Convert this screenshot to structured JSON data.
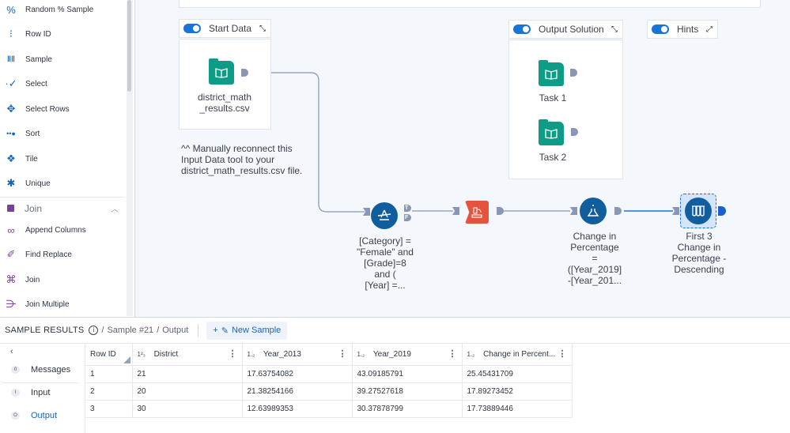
{
  "sidebar": {
    "items": [
      {
        "label": "Random % Sample",
        "icon": "random-sample-icon"
      },
      {
        "label": "Row ID",
        "icon": "row-id-icon"
      },
      {
        "label": "Sample",
        "icon": "sample-icon"
      },
      {
        "label": "Select",
        "icon": "select-icon"
      },
      {
        "label": "Select Rows",
        "icon": "select-rows-icon"
      },
      {
        "label": "Sort",
        "icon": "sort-icon"
      },
      {
        "label": "Tile",
        "icon": "tile-icon"
      },
      {
        "label": "Unique",
        "icon": "unique-icon"
      }
    ],
    "category": {
      "label": "Join",
      "color": "#7a3f9d"
    },
    "join_items": [
      {
        "label": "Append Columns",
        "icon": "append-columns-icon"
      },
      {
        "label": "Find Replace",
        "icon": "find-replace-icon"
      },
      {
        "label": "Join",
        "icon": "join-icon"
      },
      {
        "label": "Join Multiple",
        "icon": "join-multiple-icon"
      }
    ]
  },
  "canvas": {
    "containers": {
      "start_data": {
        "title": "Start Data",
        "node_label": "district_math\n_results.csv"
      },
      "output_solution": {
        "title": "Output Solution",
        "task1": "Task 1",
        "task2": "Task 2"
      },
      "hints": {
        "title": "Hints"
      }
    },
    "comment": "^^ Manually reconnect this Input Data tool to your district_math_results.csv file.",
    "filter_label": "[Category] =\n\"Female\" and\n[Grade]=8\nand (\n[Year] =...",
    "filter_anchors": {
      "true": "T",
      "false": "F"
    },
    "formula_label": "Change in\nPercentage\n=\n([Year_2019]\n-[Year_201...",
    "sample_label": "First 3\nChange in\nPercentage -\nDescending",
    "colors": {
      "input_tool": "#0f9c86",
      "filter_tool": "#115e9e",
      "transpose_tool": "#e5533d",
      "selected_connection": "#1a73d6"
    }
  },
  "results": {
    "title": "SAMPLE RESULTS",
    "breadcrumb": [
      "Sample #21",
      "Output"
    ],
    "new_sample": "New Sample",
    "nav": [
      {
        "label": "Messages",
        "badge": "0"
      },
      {
        "label": "Input",
        "badge": "I"
      },
      {
        "label": "Output",
        "badge": "O",
        "active": true
      }
    ],
    "columns": [
      {
        "name": "Row ID",
        "type": ""
      },
      {
        "name": "District",
        "type": "1²₃"
      },
      {
        "name": "Year_2013",
        "type": "1.₂"
      },
      {
        "name": "Year_2019",
        "type": "1.₂"
      },
      {
        "name": "Change in Percent...",
        "type": "1.₂"
      }
    ],
    "rows": [
      [
        "1",
        "21",
        "17.63754082",
        "43.09185791",
        "25.45431709"
      ],
      [
        "2",
        "20",
        "21.38254166",
        "39.27527618",
        "17.89273452"
      ],
      [
        "3",
        "30",
        "12.63989353",
        "30.37878799",
        "17.73889446"
      ]
    ]
  }
}
